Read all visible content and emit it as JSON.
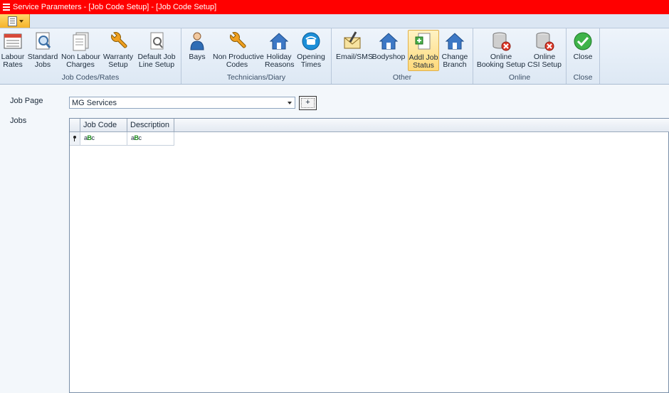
{
  "window": {
    "title": "Service Parameters - [Job Code Setup] - [Job Code Setup]"
  },
  "ribbon": {
    "groups": [
      {
        "label": "Job Codes/Rates",
        "buttons": [
          {
            "label1": "Labour",
            "label2": "Rates"
          },
          {
            "label1": "Standard",
            "label2": "Jobs"
          },
          {
            "label1": "Non Labour",
            "label2": "Charges"
          },
          {
            "label1": "Warranty",
            "label2": "Setup"
          },
          {
            "label1": "Default Job",
            "label2": "Line Setup"
          }
        ]
      },
      {
        "label": "Technicians/Diary",
        "buttons": [
          {
            "label1": "Bays",
            "label2": ""
          },
          {
            "label1": "Non Productive",
            "label2": "Codes"
          },
          {
            "label1": "Holiday",
            "label2": "Reasons"
          },
          {
            "label1": "Opening",
            "label2": "Times"
          }
        ]
      },
      {
        "label": "Other",
        "buttons": [
          {
            "label1": "Email/SMS",
            "label2": ""
          },
          {
            "label1": "Bodyshop",
            "label2": ""
          },
          {
            "label1": "Addl Job",
            "label2": "Status"
          },
          {
            "label1": "Change",
            "label2": "Branch"
          }
        ]
      },
      {
        "label": "Online",
        "buttons": [
          {
            "label1": "Online",
            "label2": "Booking Setup"
          },
          {
            "label1": "Online",
            "label2": "CSI Setup"
          }
        ]
      },
      {
        "label": "Close",
        "buttons": [
          {
            "label1": "Close",
            "label2": ""
          }
        ]
      }
    ]
  },
  "form": {
    "job_page_label": "Job Page",
    "jobs_label": "Jobs",
    "job_page_value": "MG Services",
    "add_button_label": "+"
  },
  "grid": {
    "columns": [
      "Job Code",
      "Description"
    ],
    "filter_row": {
      "glyph_prefix": "a",
      "glyph_mid": "B",
      "glyph_suffix": "c"
    }
  },
  "colors": {
    "title_bar": "#ff0000",
    "selected_button": "#ffd97a",
    "ribbon_bg": "#dde8f4"
  }
}
